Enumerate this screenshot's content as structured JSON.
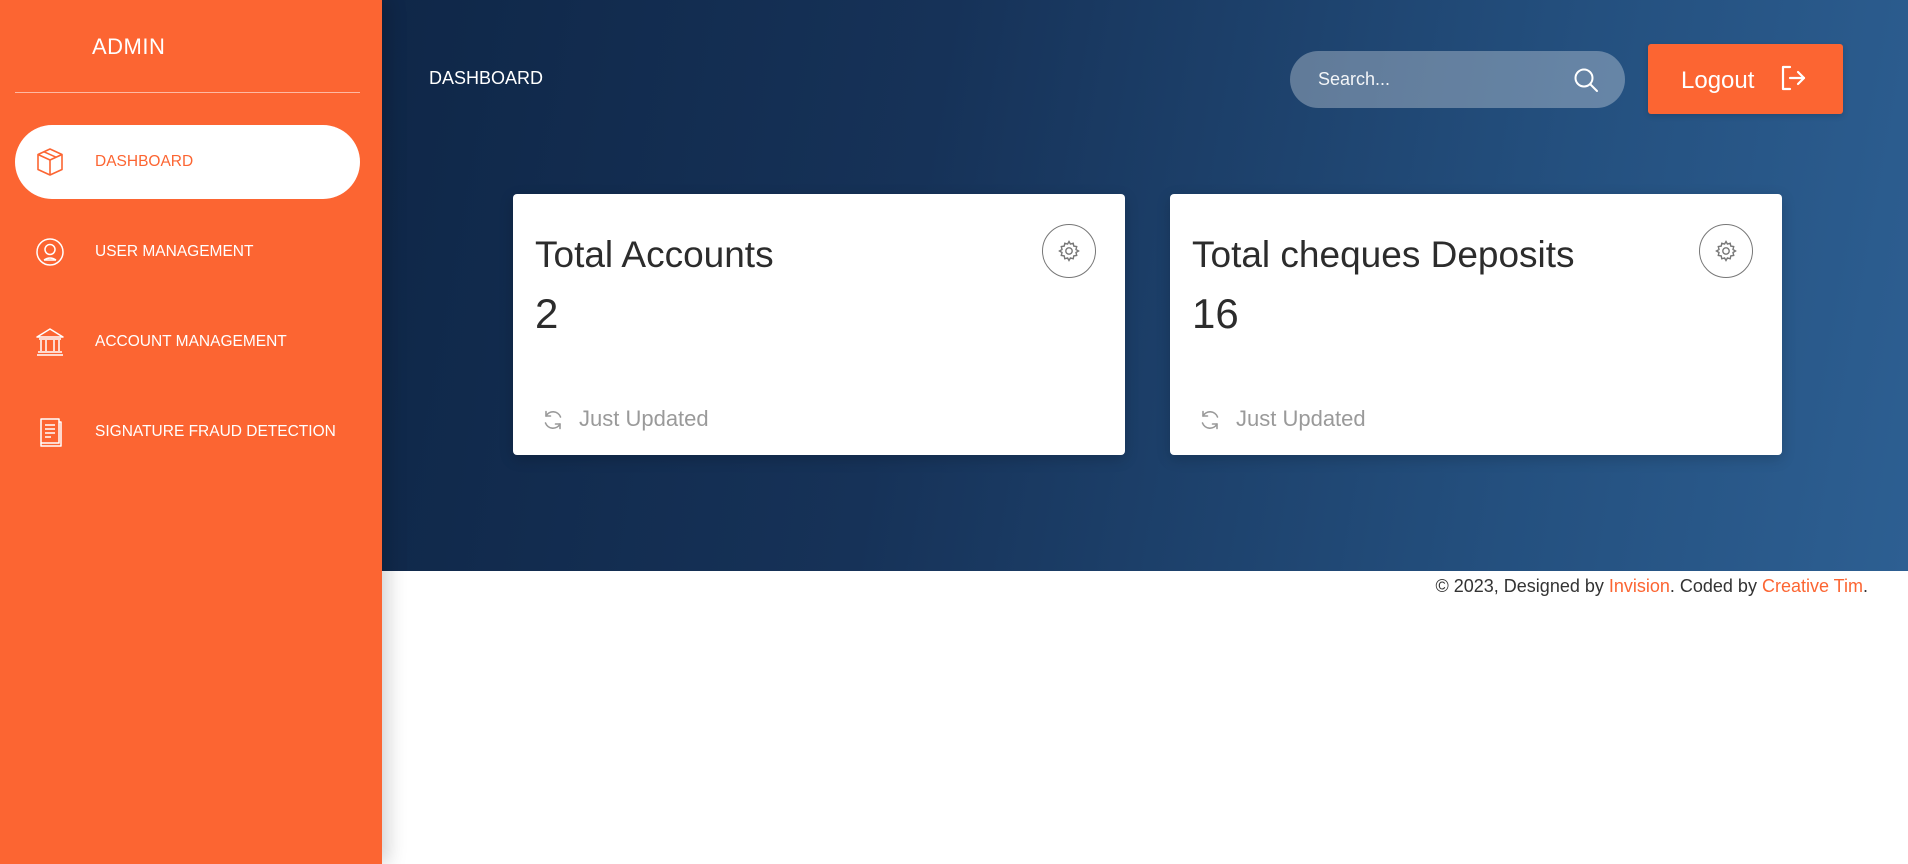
{
  "sidebar": {
    "brand": "ADMIN",
    "items": [
      {
        "label": "DASHBOARD",
        "icon": "box-icon",
        "active": true
      },
      {
        "label": "USER MANAGEMENT",
        "icon": "user-circle-icon",
        "active": false
      },
      {
        "label": "ACCOUNT MANAGEMENT",
        "icon": "bank-icon",
        "active": false
      },
      {
        "label": "SIGNATURE FRAUD DETECTION",
        "icon": "document-icon",
        "active": false
      }
    ]
  },
  "header": {
    "title": "DASHBOARD",
    "search": {
      "placeholder": "Search...",
      "value": ""
    },
    "logout_label": "Logout"
  },
  "cards": [
    {
      "title": "Total Accounts",
      "value": "2",
      "footer": "Just Updated"
    },
    {
      "title": "Total cheques Deposits",
      "value": "16",
      "footer": "Just Updated"
    }
  ],
  "footer": {
    "prefix": "© 2023, Designed by ",
    "link1": "Invision",
    "middle": ". Coded by ",
    "link2": "Creative Tim",
    "suffix": "."
  },
  "colors": {
    "accent": "#fc6532",
    "hero_dark": "#0f2748",
    "hero_light": "#2d5f92"
  }
}
